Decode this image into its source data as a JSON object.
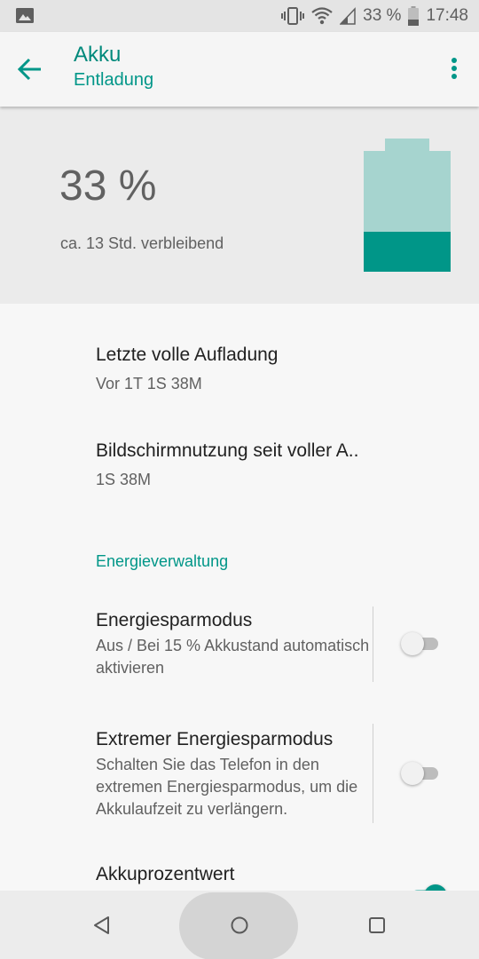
{
  "status_bar": {
    "battery_text": "33 %",
    "time": "17:48",
    "icons": [
      "gallery-icon",
      "vibrate-icon",
      "wifi-icon",
      "cell-signal-icon",
      "battery-icon"
    ]
  },
  "app_bar": {
    "title": "Akku",
    "subtitle": "Entladung",
    "back_icon": "arrow-back-icon",
    "menu_icon": "more-vert-icon"
  },
  "battery": {
    "level_percent": 33,
    "percent_text": "33 %",
    "remaining_text": "ca. 13 Std. verbleibend",
    "colors": {
      "fill": "#009688",
      "empty": "#a6d4cf"
    }
  },
  "items": [
    {
      "title": "Letzte volle Aufladung",
      "summary": "Vor 1T 1S 38M"
    },
    {
      "title": "Bildschirmnutzung seit voller A..",
      "summary": "1S 38M"
    }
  ],
  "section_title": "Energieverwaltung",
  "prefs": [
    {
      "title": "Energiesparmodus",
      "summary": "Aus / Bei 15 % Akkustand automatisch aktivieren",
      "enabled": false
    },
    {
      "title": "Extremer Energiesparmodus",
      "summary": "Schalten Sie das Telefon in den extremen Energiesparmodus, um die Akkulaufzeit zu verlängern.",
      "enabled": false
    },
    {
      "title": "Akkuprozentwert",
      "summary": "",
      "enabled": true
    }
  ],
  "nav_bar": {
    "icons": [
      "back-triangle-icon",
      "home-circle-icon",
      "recents-square-icon"
    ]
  },
  "accent_color": "#009688"
}
